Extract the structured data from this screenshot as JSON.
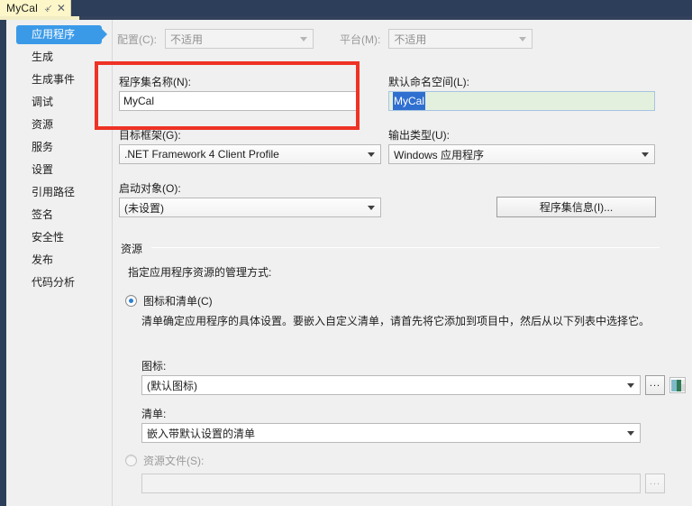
{
  "window": {
    "tab": {
      "title": "MyCal",
      "pin_icon": "pin-icon",
      "close_icon": "close-icon"
    }
  },
  "sidebar": {
    "items": [
      {
        "label": "应用程序",
        "selected": true
      },
      {
        "label": "生成",
        "selected": false
      },
      {
        "label": "生成事件",
        "selected": false
      },
      {
        "label": "调试",
        "selected": false
      },
      {
        "label": "资源",
        "selected": false
      },
      {
        "label": "服务",
        "selected": false
      },
      {
        "label": "设置",
        "selected": false
      },
      {
        "label": "引用路径",
        "selected": false
      },
      {
        "label": "签名",
        "selected": false
      },
      {
        "label": "安全性",
        "selected": false
      },
      {
        "label": "发布",
        "selected": false
      },
      {
        "label": "代码分析",
        "selected": false
      }
    ]
  },
  "main": {
    "configuration": {
      "config_label": "配置(C):",
      "config_value": "不适用",
      "platform_label": "平台(M):",
      "platform_value": "不适用"
    },
    "assembly_name": {
      "label": "程序集名称(N):",
      "value": "MyCal"
    },
    "default_namespace": {
      "label": "默认命名空间(L):",
      "value": "MyCal",
      "selected": true
    },
    "target_framework": {
      "label": "目标框架(G):",
      "value": ".NET Framework 4 Client Profile"
    },
    "output_type": {
      "label": "输出类型(U):",
      "value": "Windows 应用程序"
    },
    "startup_object": {
      "label": "启动对象(O):",
      "value": "(未设置)"
    },
    "assembly_info_button": "程序集信息(I)...",
    "resources": {
      "group_label": "资源",
      "instruction": "指定应用程序资源的管理方式:",
      "icon_manifest_radio": "图标和清单(C)",
      "manifest_description": "清单确定应用程序的具体设置。要嵌入自定义清单，请首先将它添加到项目中，然后从以下列表中选择它。",
      "icon_label": "图标:",
      "icon_value": "(默认图标)",
      "icon_browse": "...",
      "manifest_label": "清单:",
      "manifest_value": "嵌入带默认设置的清单",
      "resource_file_radio": "资源文件(S):",
      "resource_file_value": "",
      "resource_file_browse": "..."
    }
  },
  "annotation": {
    "color": "#ee3225",
    "target": "程序集名称(N):"
  }
}
